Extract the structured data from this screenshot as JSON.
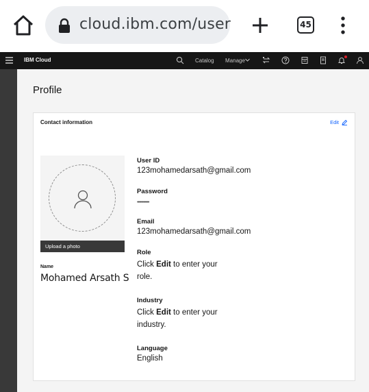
{
  "browser": {
    "url": "cloud.ibm.com/user",
    "tab_count": "45",
    "icons": [
      "home-icon",
      "lock-icon",
      "plus-icon",
      "tabs-icon",
      "kebab-menu-icon"
    ]
  },
  "masthead": {
    "brand": "IBM Cloud",
    "catalog": "Catalog",
    "manage": "Manage",
    "icons": [
      "hamburger-icon",
      "search-icon",
      "switch-icon",
      "help-icon",
      "cost-icon",
      "docs-icon",
      "notification-icon",
      "user-icon"
    ],
    "notify_color": "#da1e28"
  },
  "page": {
    "title": "Profile"
  },
  "contact": {
    "title": "Contact information",
    "edit": "Edit",
    "upload_photo": "Upload a photo",
    "name_label": "Name",
    "name_value": "Mohamed Arsath S",
    "user_id_label": "User ID",
    "user_id_value": "123mohamedarsath@gmail.com",
    "password_label": "Password",
    "password_value": "••••••••••••",
    "email_label": "Email",
    "email_value": "123mohamedarsath@gmail.com",
    "role_label": "Role",
    "role_pre": "Click ",
    "role_bold": "Edit",
    "role_post": " to enter your role.",
    "industry_label": "Industry",
    "industry_pre": "Click ",
    "industry_bold": "Edit",
    "industry_post": " to enter your industry.",
    "language_label": "Language",
    "language_value": "English"
  },
  "colors": {
    "accent": "#0f62fe",
    "masthead_bg": "#161616",
    "page_bg": "#f4f4f4"
  }
}
